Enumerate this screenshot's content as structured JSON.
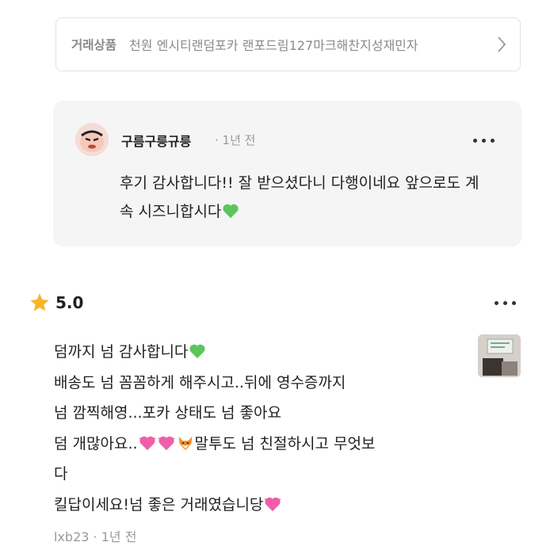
{
  "product": {
    "label": "거래상품",
    "title": "천원 엔시티랜덤포카 랜포드림127마크해찬지성재민자"
  },
  "seller_reply": {
    "username": "구름구릉규릉",
    "time": "· 1년 전",
    "text": "후기 감사합니다!! 잘 받으셨다니 다행이네요 앞으로도 계속 시즈니합시다"
  },
  "review": {
    "rating": "5.0",
    "lines": [
      "덤까지 넘 감사합니다",
      "배송도 넘 꼼꼼하게 해주시고..뒤에 영수증까지",
      "넘 깜찍해영...포카 상태도 넘 좋아요",
      "덤 개많아요..",
      "말투도 넘 친절하시고 무엇보",
      "다",
      "킬답이세요!넘 좋은 거래였습니당"
    ],
    "username": "lxb23",
    "time": "· 1년 전"
  },
  "colors": {
    "muted_text": "#8a8a8a",
    "reply_bg": "#f5f5f6",
    "green_heart": "#5cc65a",
    "pink_heart": "#ee5fa8",
    "star": "#f7b52b"
  },
  "icons": [
    "chevron-right-icon",
    "more-dots-icon",
    "star-icon",
    "green-heart-emoji",
    "pink-heart-emoji",
    "fox-emoji"
  ]
}
